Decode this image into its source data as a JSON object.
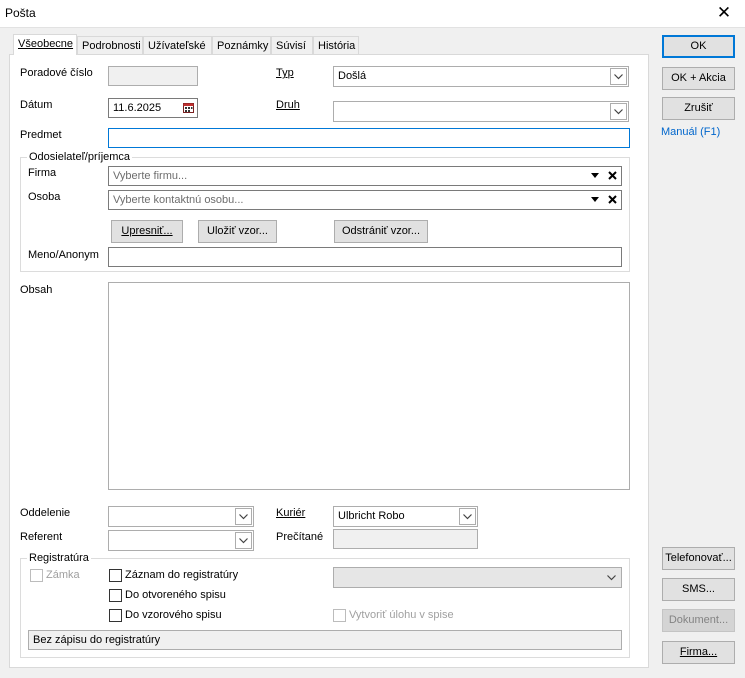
{
  "window": {
    "title": "Pošta"
  },
  "tabs": [
    "Všeobecne",
    "Podrobnosti",
    "Užívateľské",
    "Poznámky",
    "Súvisí",
    "História"
  ],
  "form": {
    "poradove_cislo": {
      "label": "Poradové číslo",
      "value": ""
    },
    "typ": {
      "label": "Typ",
      "value": "Došlá"
    },
    "datum": {
      "label": "Dátum",
      "value": "11.6.2025"
    },
    "druh": {
      "label": "Druh",
      "value": ""
    },
    "predmet": {
      "label": "Predmet",
      "value": ""
    },
    "odosielatel": {
      "group_title": "Odosielateľ/príjemca",
      "firma_label": "Firma",
      "firma_placeholder": "Vyberte firmu...",
      "osoba_label": "Osoba",
      "osoba_placeholder": "Vyberte kontaktnú osobu...",
      "upresnit": "Upresniť...",
      "ulozit_vzor": "Uložiť vzor...",
      "odstranit_vzor": "Odstrániť vzor...",
      "meno_label": "Meno/Anonym",
      "meno_value": ""
    },
    "obsah": {
      "label": "Obsah",
      "value": ""
    },
    "oddelenie": {
      "label": "Oddelenie",
      "value": ""
    },
    "referent": {
      "label": "Referent",
      "value": ""
    },
    "kurier": {
      "label": "Kuriér",
      "value": "Ulbricht Robo"
    },
    "precitane": {
      "label": "Prečítané",
      "value": ""
    },
    "registratura": {
      "group_title": "Registratúra",
      "zamka": "Zámka",
      "zaznam": "Záznam do registratúry",
      "do_otvoreneho": "Do otvoreného spisu",
      "do_vzoroveho": "Do vzorového spisu",
      "vytvorit_ulohu": "Vytvoriť úlohu v spise",
      "combo_value": "",
      "status": "Bez zápisu do registratúry"
    }
  },
  "buttons": {
    "ok": "OK",
    "ok_akcia": "OK + Akcia",
    "zrusit": "Zrušiť",
    "manual": "Manuál (F1)",
    "telefonovat": "Telefonovať...",
    "sms": "SMS...",
    "dokument": "Dokument...",
    "firma": "Firma..."
  },
  "icons": {
    "close": "close-icon",
    "calendar": "calendar-icon",
    "dropdown": "chevron-down-icon",
    "clear": "clear-x-icon"
  }
}
